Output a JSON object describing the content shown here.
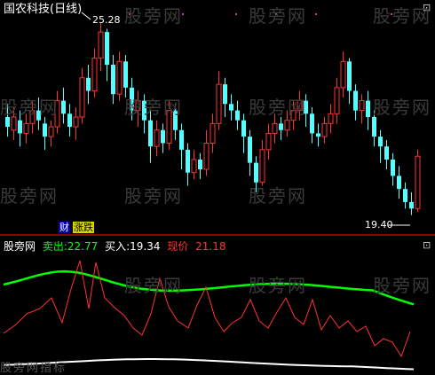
{
  "chart": {
    "title": "国农科技(日线)",
    "high_label": "25.28",
    "low_label": "19.40",
    "badges": [
      {
        "text": "财",
        "color": "#ffffff",
        "bg": "#0000aa"
      },
      {
        "text": "涨跌",
        "color": "#000000",
        "bg": "#d8d800"
      }
    ],
    "colors": {
      "up": "#ff3232",
      "down": "#54ffff",
      "bg": "#000000"
    }
  },
  "indicator": {
    "name": "股旁网",
    "sell_label": "卖出:",
    "sell_value": "22.77",
    "buy_label": "买入:",
    "buy_value": "19.34",
    "price_label": "现价",
    "price_value": "21.18",
    "colors": {
      "sell": "#00ff00",
      "buy": "#ffffff",
      "price": "#ff3232"
    }
  },
  "watermark": "股旁网",
  "bottom_watermark": "股旁网指标"
}
